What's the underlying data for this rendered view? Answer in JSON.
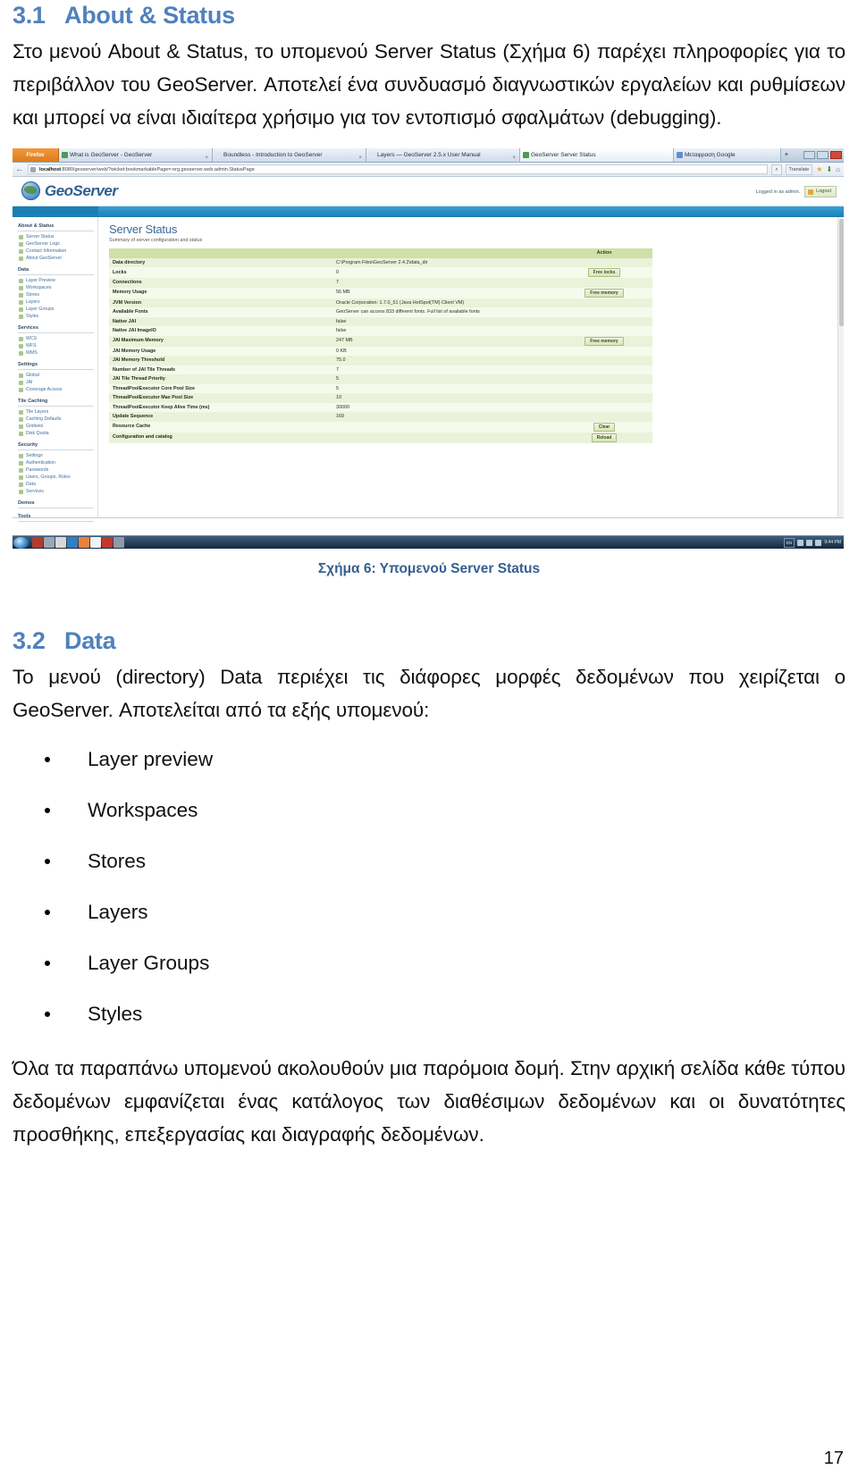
{
  "document": {
    "page_number": "17"
  },
  "section_3_1": {
    "number": "3.1",
    "title": "About & Status",
    "paragraph": "Στο μενού About & Status, το υπομενού Server Status (Σχήμα 6) παρέχει πληροφορίες για το περιβάλλον του GeoServer. Αποτελεί ένα συνδυασμό διαγνωστικών εργαλείων και ρυθμίσεων και μπορεί να είναι ιδιαίτερα χρήσιμο για τον εντοπισμό σφαλμάτων (debugging)."
  },
  "figure": {
    "caption": "Σχήμα 6: Υπομενού Server Status",
    "browser": {
      "firefox_button": "Firefox",
      "tabs": [
        {
          "title": "What is GeoServer - GeoServer",
          "active": false
        },
        {
          "title": "Boundless - Introduction to GeoServer",
          "active": false
        },
        {
          "title": "Layers — GeoServer 2.5.x User Manual",
          "active": false
        },
        {
          "title": "GeoServer Server Status",
          "active": true
        },
        {
          "title": "Μεταφραση Google",
          "active": false
        }
      ],
      "new_tab_label": "+",
      "url_prefix": "localhost",
      "url": ":8080/geoserver/web/?wicket:bookmarkablePage=:org.geoserver.web.admin.StatusPage",
      "translate_label": "Translate",
      "window_buttons": [
        "minimize",
        "maximize",
        "close"
      ]
    },
    "geoserver": {
      "brand": "GeoServer",
      "logged_in_as": "Logged in as admin.",
      "logout_label": "Logout",
      "page_title": "Server Status",
      "page_subtitle": "Summary of server configuration and status",
      "sidebar": [
        {
          "title": "About & Status",
          "items": [
            "Server Status",
            "GeoServer Logs",
            "Contact Information",
            "About GeoServer"
          ]
        },
        {
          "title": "Data",
          "items": [
            "Layer Preview",
            "Workspaces",
            "Stores",
            "Layers",
            "Layer Groups",
            "Styles"
          ]
        },
        {
          "title": "Services",
          "items": [
            "WCS",
            "WFS",
            "WMS"
          ]
        },
        {
          "title": "Settings",
          "items": [
            "Global",
            "JAI",
            "Coverage Access"
          ]
        },
        {
          "title": "Tile Caching",
          "items": [
            "Tile Layers",
            "Caching Defaults",
            "Gridsets",
            "Disk Quota"
          ]
        },
        {
          "title": "Security",
          "items": [
            "Settings",
            "Authentication",
            "Passwords",
            "Users, Groups, Roles",
            "Data",
            "Services"
          ]
        },
        {
          "title": "Demos",
          "items": []
        },
        {
          "title": "Tools",
          "items": []
        }
      ],
      "table": {
        "columns": [
          "",
          "",
          "Action"
        ],
        "rows": [
          {
            "property": "Data directory",
            "value": "C:\\Program Files\\GeoServer 2.4.2\\data_dir",
            "action": ""
          },
          {
            "property": "Locks",
            "value": "0",
            "action": "Free locks"
          },
          {
            "property": "Connections",
            "value": "7",
            "action": ""
          },
          {
            "property": "Memory Usage",
            "value": "56 MB",
            "action": "Free memory"
          },
          {
            "property": "JVM Version",
            "value": "Oracle Corporation: 1.7.0_51 (Java HotSpot(TM) Client VM)",
            "action": ""
          },
          {
            "property": "Available Fonts",
            "value": "GeoServer can access 833 different fonts. Full list of available fonts",
            "action": ""
          },
          {
            "property": "Native JAI",
            "value": "false",
            "action": ""
          },
          {
            "property": "Native JAI ImageIO",
            "value": "false",
            "action": ""
          },
          {
            "property": "JAI Maximum Memory",
            "value": "247 MB",
            "action": "Free memory"
          },
          {
            "property": "JAI Memory Usage",
            "value": "0 KB",
            "action": ""
          },
          {
            "property": "JAI Memory Threshold",
            "value": "75.0",
            "action": ""
          },
          {
            "property": "Number of JAI Tile Threads",
            "value": "7",
            "action": ""
          },
          {
            "property": "JAI Tile Thread Priority",
            "value": "5",
            "action": ""
          },
          {
            "property": "ThreadPoolExecutor Core Pool Size",
            "value": "5",
            "action": ""
          },
          {
            "property": "ThreadPoolExecutor Max Pool Size",
            "value": "10",
            "action": ""
          },
          {
            "property": "ThreadPoolExecutor Keep Alive Time (ms)",
            "value": "30000",
            "action": ""
          },
          {
            "property": "Update Sequence",
            "value": "169",
            "action": ""
          },
          {
            "property": "Resource Cache",
            "value": "",
            "action": "Clear"
          },
          {
            "property": "Configuration and catalog",
            "value": "",
            "action": "Reload"
          }
        ]
      }
    },
    "taskbar": {
      "clock": "9:44 PM",
      "language": "EN"
    }
  },
  "section_3_2": {
    "number": "3.2",
    "title": "Data",
    "paragraph": "Το μενού (directory) Data περιέχει τις διάφορες μορφές δεδομένων που χειρίζεται ο GeoServer. Αποτελείται από τα εξής υπομενού:",
    "bullets": [
      "Layer preview",
      "Workspaces",
      "Stores",
      "Layers",
      "Layer Groups",
      "Styles"
    ],
    "closing_paragraph": "Όλα τα παραπάνω υπομενού ακολουθούν μια παρόμοια δομή. Στην αρχική σελίδα κάθε τύπου δεδομένων εμφανίζεται ένας κατάλογος των διαθέσιμων δεδομένων και οι δυνατότητες προσθήκης, επεξεργασίας και διαγραφής δεδομένων."
  }
}
